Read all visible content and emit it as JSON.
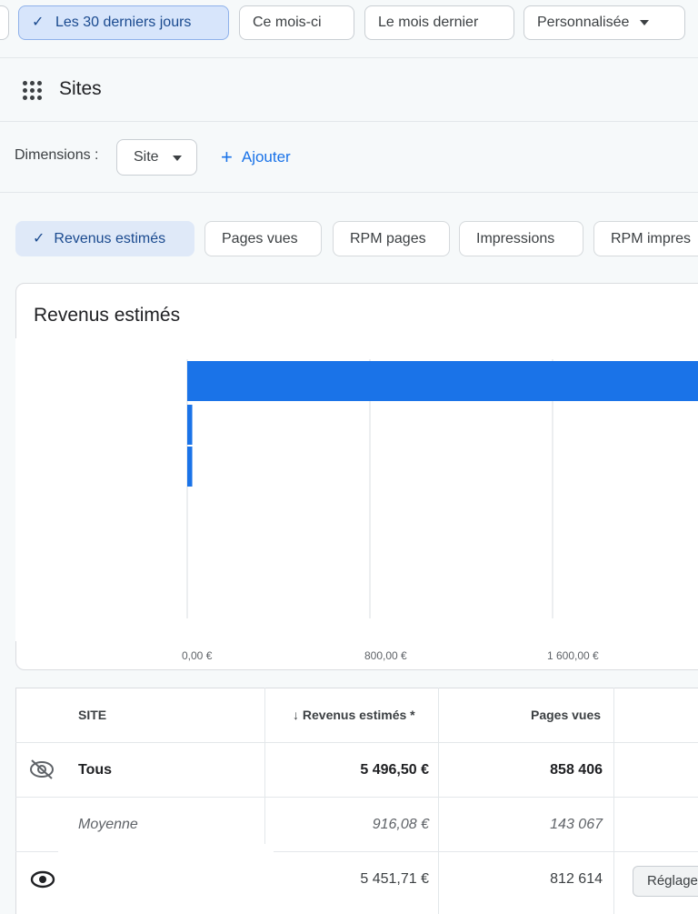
{
  "date_filters": {
    "items": [
      {
        "label": "Les 30 derniers jours",
        "selected": true
      },
      {
        "label": "Ce mois-ci",
        "selected": false
      },
      {
        "label": "Le mois dernier",
        "selected": false
      },
      {
        "label": "Personnalisée",
        "selected": false,
        "has_dropdown": true
      }
    ]
  },
  "sites_section": {
    "icon": "apps-grid-icon",
    "title": "Sites"
  },
  "dimensions": {
    "label": "Dimensions :",
    "selected_value": "Site",
    "add_label": "Ajouter"
  },
  "metrics": {
    "items": [
      {
        "label": "Revenus estimés",
        "selected": true
      },
      {
        "label": "Pages vues",
        "selected": false
      },
      {
        "label": "RPM pages",
        "selected": false
      },
      {
        "label": "Impressions",
        "selected": false
      },
      {
        "label": "RPM impres",
        "selected": false
      }
    ]
  },
  "chart_data": {
    "type": "bar",
    "orientation": "horizontal",
    "title": "Revenus estimés",
    "x_tick_labels": [
      "0,00 €",
      "800,00 €",
      "1 600,00 €"
    ],
    "x_ticks": [
      0,
      800,
      1600
    ],
    "values": [
      5451.71,
      22,
      22
    ],
    "bar_color": "#1a73e8",
    "grid": true
  },
  "table": {
    "headers": {
      "site": "SITE",
      "revenue": "Revenus estimés *",
      "pageviews": "Pages vues"
    },
    "rows": [
      {
        "site": "Tous",
        "revenue": "5 496,50 €",
        "pageviews": "858 406",
        "style": "bold",
        "icon": "visibility-off-icon"
      },
      {
        "site": "Moyenne",
        "revenue": "916,08 €",
        "pageviews": "143 067",
        "style": "italic"
      },
      {
        "site": "",
        "revenue": "5 451,71 €",
        "pageviews": "812 614",
        "style": "normal",
        "icon": "eye-icon",
        "action": "Réglages"
      }
    ]
  },
  "colors": {
    "accent": "#1a73e8",
    "selected_chip_bg": "#d7e5fb",
    "page_bg": "#f6f9fa"
  }
}
